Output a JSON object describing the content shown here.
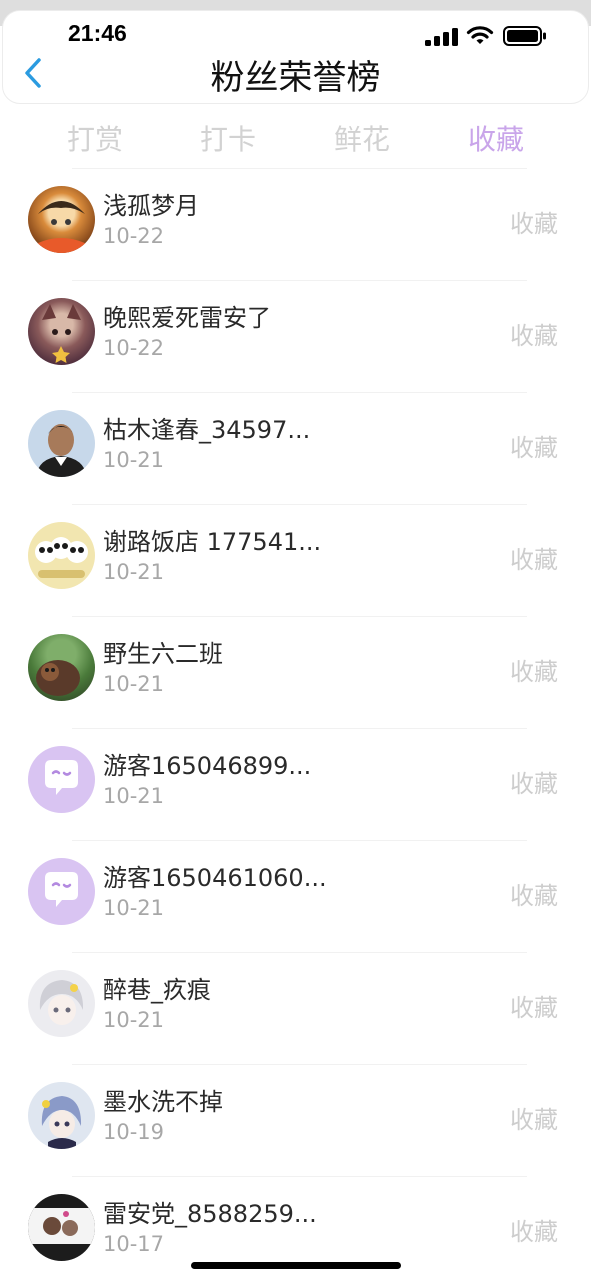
{
  "status": {
    "time": "21:46"
  },
  "nav": {
    "title": "粉丝荣誉榜"
  },
  "tabs": [
    {
      "label": "打赏",
      "active": false
    },
    {
      "label": "打卡",
      "active": false
    },
    {
      "label": "鲜花",
      "active": false
    },
    {
      "label": "收藏",
      "active": true
    }
  ],
  "colors": {
    "accent": "#c9a5ea",
    "inactive_tab": "#d2d2d2",
    "action": "#cdcdcd"
  },
  "fans": [
    {
      "name": "浅孤梦月",
      "date": "10-22",
      "action": "收藏",
      "avatar": "anime-avatar-orange"
    },
    {
      "name": "晚熙爱死雷安了",
      "date": "10-22",
      "action": "收藏",
      "avatar": "anime-avatar-brown"
    },
    {
      "name": "枯木逢春_34597...",
      "date": "10-21",
      "action": "收藏",
      "avatar": "photo-avatar-man"
    },
    {
      "name": "谢路饭店 177541...",
      "date": "10-21",
      "action": "收藏",
      "avatar": "panda-avatar"
    },
    {
      "name": "野生六二班",
      "date": "10-21",
      "action": "收藏",
      "avatar": "monkey-avatar"
    },
    {
      "name": "游客165046899...",
      "date": "10-21",
      "action": "收藏",
      "avatar": "default-chat-avatar"
    },
    {
      "name": "游客1650461060...",
      "date": "10-21",
      "action": "收藏",
      "avatar": "default-chat-avatar"
    },
    {
      "name": "醉巷_疚痕",
      "date": "10-21",
      "action": "收藏",
      "avatar": "anime-avatar-white"
    },
    {
      "name": "墨水洗不掉",
      "date": "10-19",
      "action": "收藏",
      "avatar": "anime-avatar-blue"
    },
    {
      "name": "雷安党_8588259...",
      "date": "10-17",
      "action": "收藏",
      "avatar": "anime-avatar-dark"
    }
  ]
}
